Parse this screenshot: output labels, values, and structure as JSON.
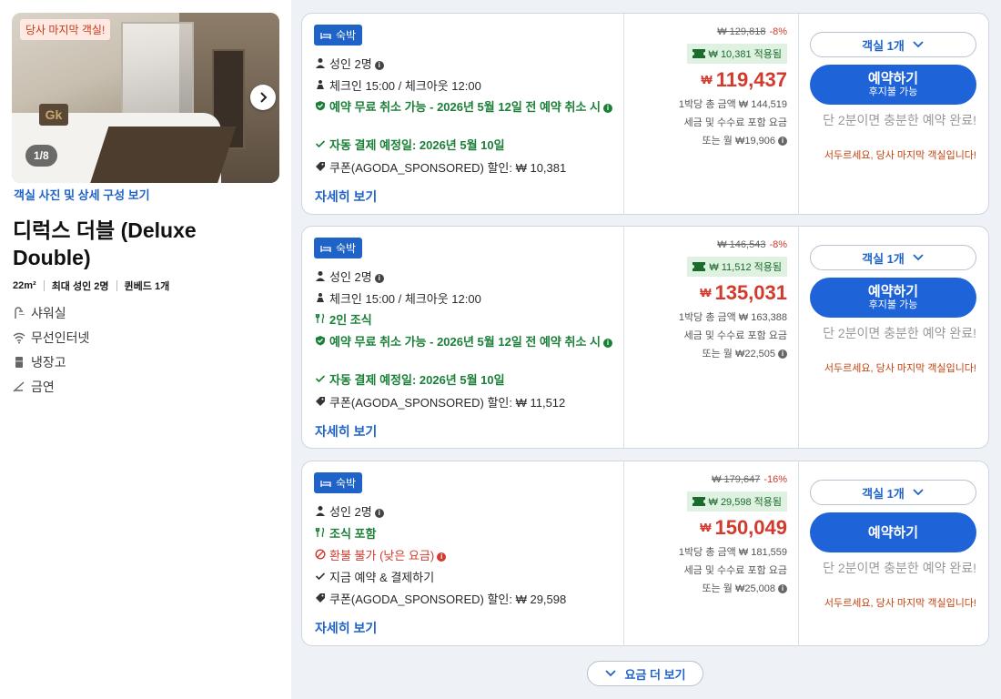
{
  "room": {
    "last_room_badge": "당사 마지막 객실!",
    "photo_counter": "1/8",
    "photos_link": "객실 사진 및 상세 구성 보기",
    "title": "디럭스 더블 (Deluxe Double)",
    "size": "22m²",
    "max_guests": "최대 성인 2명",
    "bed": "퀸베드 1개",
    "amenities": [
      {
        "icon": "shower-icon",
        "label": "샤워실"
      },
      {
        "icon": "wifi-icon",
        "label": "무선인터넷"
      },
      {
        "icon": "fridge-icon",
        "label": "냉장고"
      },
      {
        "icon": "no-smoking-icon",
        "label": "금연"
      }
    ]
  },
  "offers": [
    {
      "tag": "숙박",
      "guests": "성인 2명",
      "checkin": "체크인 15:00 / 체크아웃 12:00",
      "cancel": "예약 무료 취소 가능 - 2026년 5월 12일 전 예약 취소 시",
      "payment": "자동 결제 예정일: 2026년 5월 10일",
      "coupon": "쿠폰(AGODA_SPONSORED) 할인: ₩ 10,381",
      "more_link": "자세히 보기",
      "old_price": "₩ 129,818",
      "discount_pct": "-8%",
      "coupon_applied": "₩ 10,381 적용됨",
      "currency": "₩",
      "price": "119,437",
      "line1": "1박당 총 금액 ₩ 144,519",
      "line2": "세금 및 수수료 포함 요금",
      "line3": "또는 월 ₩19,906",
      "rooms_select": "객실 1개",
      "book_label": "예약하기",
      "book_sub": "후지불 가능",
      "urgency": "단 2분이면 충분한 예약 완료!",
      "warning": "서두르세요, 당사 마지막 객실입니다!"
    },
    {
      "tag": "숙박",
      "guests": "성인 2명",
      "checkin": "체크인 15:00 / 체크아웃 12:00",
      "breakfast": "2인 조식",
      "cancel": "예약 무료 취소 가능 - 2026년 5월 12일 전 예약 취소 시",
      "payment": "자동 결제 예정일: 2026년 5월 10일",
      "coupon": "쿠폰(AGODA_SPONSORED) 할인: ₩ 11,512",
      "more_link": "자세히 보기",
      "old_price": "₩ 146,543",
      "discount_pct": "-8%",
      "coupon_applied": "₩ 11,512 적용됨",
      "currency": "₩",
      "price": "135,031",
      "line1": "1박당 총 금액 ₩ 163,388",
      "line2": "세금 및 수수료 포함 요금",
      "line3": "또는 월 ₩22,505",
      "rooms_select": "객실 1개",
      "book_label": "예약하기",
      "book_sub": "후지불 가능",
      "urgency": "단 2분이면 충분한 예약 완료!",
      "warning": "서두르세요, 당사 마지막 객실입니다!"
    },
    {
      "tag": "숙박",
      "guests": "성인 2명",
      "breakfast": "조식 포함",
      "refund": "환불 불가 (낮은 요금)",
      "payment": "지금 예약 & 결제하기",
      "coupon": "쿠폰(AGODA_SPONSORED) 할인: ₩ 29,598",
      "more_link": "자세히 보기",
      "old_price": "₩ 179,647",
      "discount_pct": "-16%",
      "coupon_applied": "₩ 29,598 적용됨",
      "currency": "₩",
      "price": "150,049",
      "line1": "1박당 총 금액 ₩ 181,559",
      "line2": "세금 및 수수료 포함 요금",
      "line3": "또는 월 ₩25,008",
      "rooms_select": "객실 1개",
      "book_label": "예약하기",
      "urgency": "단 2분이면 충분한 예약 완료!",
      "warning": "서두르세요, 당사 마지막 객실입니다!"
    }
  ],
  "more_rates": "요금 더 보기"
}
